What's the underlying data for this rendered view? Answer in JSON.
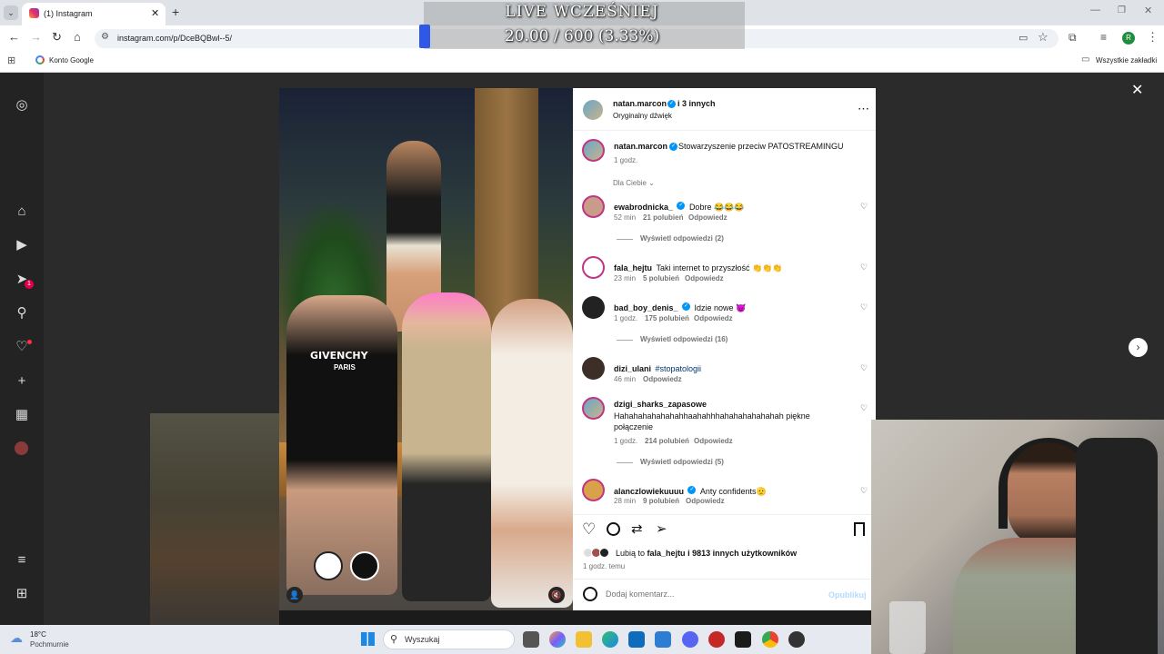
{
  "browser": {
    "tab_title": "(1) Instagram",
    "url": "instagram.com/p/DceBQBwl--5/",
    "bookmark_google": "Konto Google",
    "bookmarks_all": "Wszystkie zakładki",
    "profile_initial": "R"
  },
  "overlay": {
    "title": "LIVE WCZEŚNIEJ",
    "value": "20.00 / 600 (3.33%)",
    "progress_fraction": 0.0333
  },
  "sidebar": {
    "notif_badge": "1"
  },
  "post": {
    "header_user": "natan.marcon",
    "header_suffix": "i 3 innych",
    "header_audio": "Oryginalny dźwięk",
    "caption_user": "natan.marcon",
    "caption_text": "Stowarzyszenie przeciw PATOSTREAMINGU",
    "caption_time": "1 godz.",
    "sort_label": "Dla Ciebie",
    "likes_prefix": "Lubią to",
    "likes_user": "fala_hejtu",
    "likes_suffix": "i 9813 innych użytkowników",
    "post_time": "1 godz. temu",
    "comment_placeholder": "Dodaj komentarz...",
    "publish_label": "Opublikuj"
  },
  "comments": [
    {
      "user": "ewabrodnicka_",
      "text": "Dobre 😂😂😂",
      "time": "52 min",
      "likes": "21 polubień",
      "reply": "Odpowiedz"
    },
    {
      "user": "fala_hejtu",
      "text": "Taki internet to przyszłość 👏👏👏",
      "time": "23 min",
      "likes": "5 polubień",
      "reply": "Odpowiedz"
    },
    {
      "user": "bad_boy_denis_",
      "text": "Idzie nowe 😈",
      "time": "1 godz.",
      "likes": "175 polubień",
      "reply": "Odpowiedz"
    },
    {
      "user": "dizi_ulani",
      "text": "#stopatologii",
      "time": "46 min",
      "likes": "",
      "reply": "Odpowiedz"
    },
    {
      "user": "dzigi_sharks_zapasowe",
      "text": "Hahahahahahahahhaahahhhahahahahahahah piękne połączenie",
      "time": "1 godz.",
      "likes": "214 polubień",
      "reply": "Odpowiedz"
    },
    {
      "user": "alanczlowiekuuuu",
      "text": "Anty confidents🫡",
      "time": "28 min",
      "likes": "9 polubień",
      "reply": "Odpowiedz"
    }
  ],
  "view_replies": [
    "Wyświetl odpowiedzi (2)",
    "Wyświetl odpowiedzi (16)",
    "Wyświetl odpowiedzi (5)"
  ],
  "photo": {
    "shirt_text_1": "GIVENCHY",
    "shirt_text_2": "PARIS"
  },
  "taskbar": {
    "weather_temp": "18°C",
    "weather_desc": "Pochmurnie",
    "search_label": "Wyszukaj"
  },
  "colors": {
    "verified": "#0095f6",
    "link": "#00376b",
    "accent_blue": "#0095f6",
    "progress": "#2f58e8"
  }
}
